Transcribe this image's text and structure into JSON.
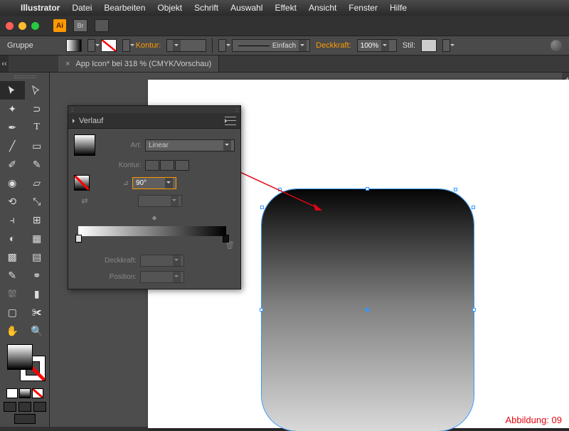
{
  "menubar": {
    "app": "Illustrator",
    "items": [
      "Datei",
      "Bearbeiten",
      "Objekt",
      "Schrift",
      "Auswahl",
      "Effekt",
      "Ansicht",
      "Fenster",
      "Hilfe"
    ]
  },
  "appbar": {
    "badge": "Ai"
  },
  "ctrlbar": {
    "selection": "Gruppe",
    "stroke_label": "Kontur:",
    "profile_label": "Einfach",
    "opacity_label": "Deckkraft:",
    "opacity_value": "100%",
    "style_label": "Stil:"
  },
  "doc_tab": {
    "title": "App Icon* bei 318 % (CMYK/Vorschau)"
  },
  "panel": {
    "title": "Verlauf",
    "type_label": "Art:",
    "type_value": "Linear",
    "stroke_label": "Kontur:",
    "angle_value": "90°",
    "opacity_label": "Deckkraft:",
    "position_label": "Position:"
  },
  "caption": "Abbildung: 09",
  "chart_data": null
}
